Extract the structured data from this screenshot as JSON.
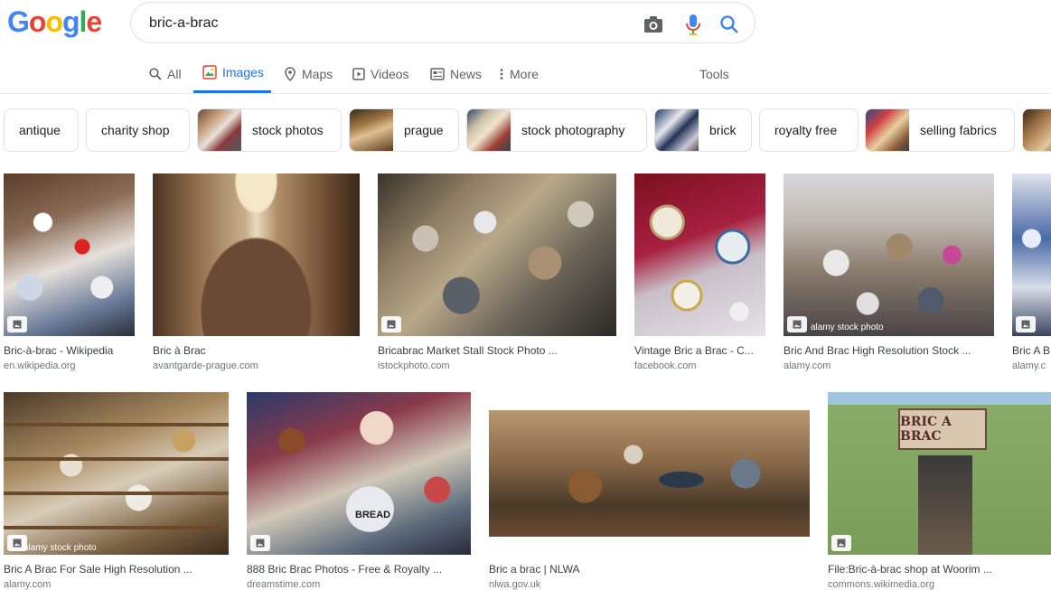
{
  "logo": {
    "letters": [
      "G",
      "o",
      "o",
      "g",
      "l",
      "e"
    ],
    "colors": [
      "#4285f4",
      "#ea4335",
      "#fbbc05",
      "#4285f4",
      "#34a853",
      "#ea4335"
    ]
  },
  "search": {
    "value": "bric-a-brac",
    "icons": [
      "camera-icon",
      "microphone-icon",
      "search-icon"
    ]
  },
  "tabs": [
    {
      "label": "All",
      "icon": "search-icon",
      "active": false
    },
    {
      "label": "Images",
      "icon": "image-icon",
      "active": true
    },
    {
      "label": "Maps",
      "icon": "map-pin-icon",
      "active": false
    },
    {
      "label": "Videos",
      "icon": "video-icon",
      "active": false
    },
    {
      "label": "News",
      "icon": "news-icon",
      "active": false
    },
    {
      "label": "More",
      "icon": "more-dots-icon",
      "active": false
    }
  ],
  "tools_label": "Tools",
  "chips": [
    {
      "label": "antique",
      "thumb": false
    },
    {
      "label": "charity shop",
      "thumb": false
    },
    {
      "label": "stock photos",
      "thumb": true
    },
    {
      "label": "prague",
      "thumb": true
    },
    {
      "label": "stock photography",
      "thumb": true
    },
    {
      "label": "brick",
      "thumb": true
    },
    {
      "label": "royalty free",
      "thumb": false
    },
    {
      "label": "selling fabrics",
      "thumb": true
    },
    {
      "label": "",
      "thumb": true
    }
  ],
  "results": [
    {
      "title": "Bric-à-brac - Wikipedia",
      "source": "en.wikipedia.org",
      "watermark": ""
    },
    {
      "title": "Bric à Brac",
      "source": "avantgarde-prague.com",
      "watermark": ""
    },
    {
      "title": "Bricabrac Market Stall Stock Photo ...",
      "source": "istockphoto.com",
      "watermark": ""
    },
    {
      "title": "Vintage Bric a Brac - C...",
      "source": "facebook.com",
      "watermark": ""
    },
    {
      "title": "Bric And Brac High Resolution Stock ...",
      "source": "alamy.com",
      "watermark": "alamy stock photo"
    },
    {
      "title": "Bric A B",
      "source": "alamy.c",
      "watermark": ""
    },
    {
      "title": "Bric A Brac For Sale High Resolution ...",
      "source": "alamy.com",
      "watermark": "alamy stock photo"
    },
    {
      "title": "888 Bric Brac Photos - Free & Royalty ...",
      "source": "dreamstime.com",
      "watermark": ""
    },
    {
      "title": "Bric a brac | NLWA",
      "source": "nlwa.gov.uk",
      "watermark": ""
    },
    {
      "title": "File:Bric-à-brac shop at Woorim ...",
      "source": "commons.wikimedia.org",
      "watermark": ""
    }
  ],
  "shop_sign": "BRIC A BRAC",
  "bread_tin_label": "BREAD"
}
